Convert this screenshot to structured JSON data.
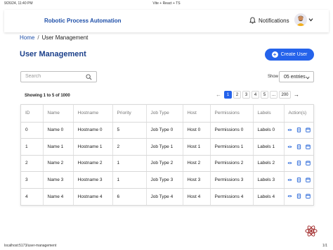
{
  "print": {
    "date": "9/26/24, 11:40 PM",
    "title": "Vite + React + TS",
    "url": "localhost:5173/user-management",
    "page": "1/1"
  },
  "navbar": {
    "brand": "Robotic Process Automation",
    "notifications_label": "Notifications",
    "icons": [
      "bell-icon",
      "avatar",
      "chevron-down-icon"
    ]
  },
  "breadcrumb": {
    "home": "Home",
    "separator": "/",
    "current": "User Management"
  },
  "page": {
    "title": "User Management",
    "create_button": "Create User"
  },
  "search": {
    "placeholder": "Search",
    "value": ""
  },
  "entries": {
    "label": "Show",
    "selected": "05 entries"
  },
  "summary": "Showing 1 to 5 of 1000",
  "pagination": {
    "prev": "←",
    "pages": [
      "1",
      "2",
      "3",
      "4",
      "5",
      "...",
      "200"
    ],
    "active": "1",
    "next": "→"
  },
  "table": {
    "columns": [
      "ID",
      "Name",
      "Hostname",
      "Priority",
      "Job Type",
      "Host",
      "Permissions",
      "Labels",
      "Action(s)"
    ],
    "rows": [
      [
        "0",
        "Name 0",
        "Hostname 0",
        "5",
        "Job Type 0",
        "Host 0",
        "Permissions 0",
        "Labels 0"
      ],
      [
        "1",
        "Name 1",
        "Hostname 1",
        "2",
        "Job Type 1",
        "Host 1",
        "Permissions 1",
        "Labels 1"
      ],
      [
        "2",
        "Name 2",
        "Hostname 2",
        "1",
        "Job Type 2",
        "Host 2",
        "Permissions 2",
        "Labels 2"
      ],
      [
        "3",
        "Name 3",
        "Hostname 3",
        "1",
        "Job Type 3",
        "Host 3",
        "Permissions 3",
        "Labels 3"
      ],
      [
        "4",
        "Name 4",
        "Hostname 4",
        "6",
        "Job Type 4",
        "Host 4",
        "Permissions 4",
        "Labels 4"
      ]
    ],
    "action_icons": [
      "view-icon",
      "edit-icon",
      "delete-icon"
    ]
  },
  "colors": {
    "primary": "#2563eb",
    "brand_text": "#1d4ea8",
    "title_text": "#1a3f8a"
  }
}
